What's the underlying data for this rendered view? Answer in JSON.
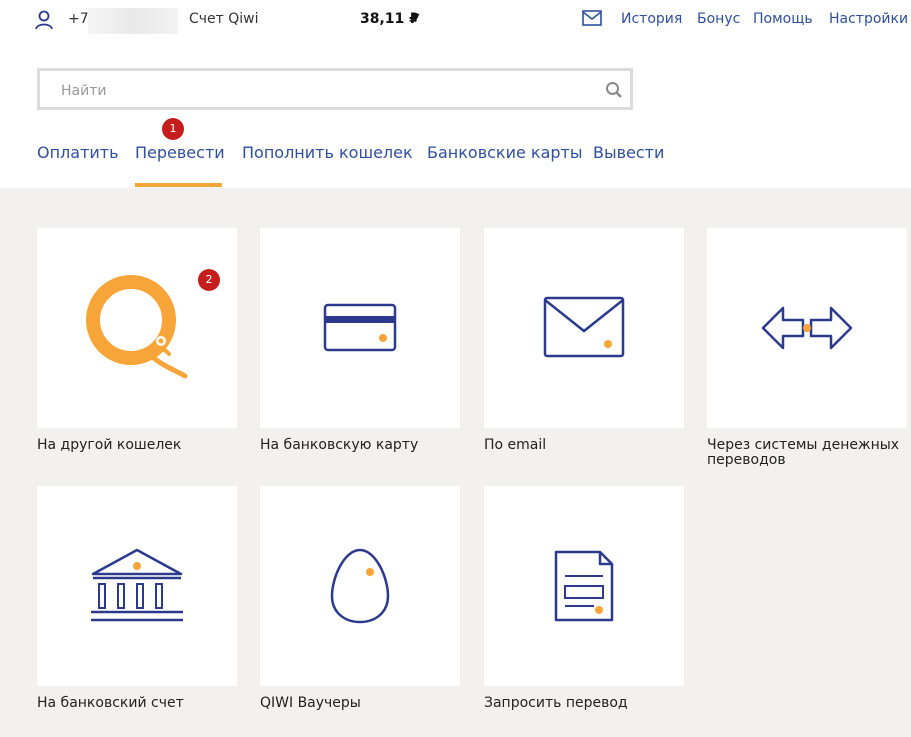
{
  "header": {
    "phone": "+79",
    "account": "Счет Qiwi",
    "balance": "38,11 ₽",
    "balance_arrow": "▼",
    "links": [
      "История",
      "Бонус",
      "Помощь",
      "Настройки"
    ]
  },
  "search": {
    "placeholder": "Найти"
  },
  "tabs": [
    "Оплатить",
    "Перевести",
    "Пополнить кошелек",
    "Банковские карты",
    "Вывести"
  ],
  "badges": [
    "1",
    "2"
  ],
  "tiles": [
    {
      "label": "На другой кошелек",
      "icon": "qiwi-logo-icon"
    },
    {
      "label": "На банковскую карту",
      "icon": "bank-card-icon"
    },
    {
      "label": "По email",
      "icon": "envelope-icon"
    },
    {
      "label": "Через системы денежных переводов",
      "icon": "transfer-arrows-icon"
    },
    {
      "label": "На банковский счет",
      "icon": "bank-building-icon"
    },
    {
      "label": "QIWI Ваучеры",
      "icon": "egg-voucher-icon"
    },
    {
      "label": "Запросить перевод",
      "icon": "document-request-icon"
    }
  ],
  "colors": {
    "accent": "#f7a538",
    "link": "#2f4f9d",
    "icon": "#2b3a8c",
    "badge": "#c51d1d",
    "background": "#f2f1ef"
  }
}
